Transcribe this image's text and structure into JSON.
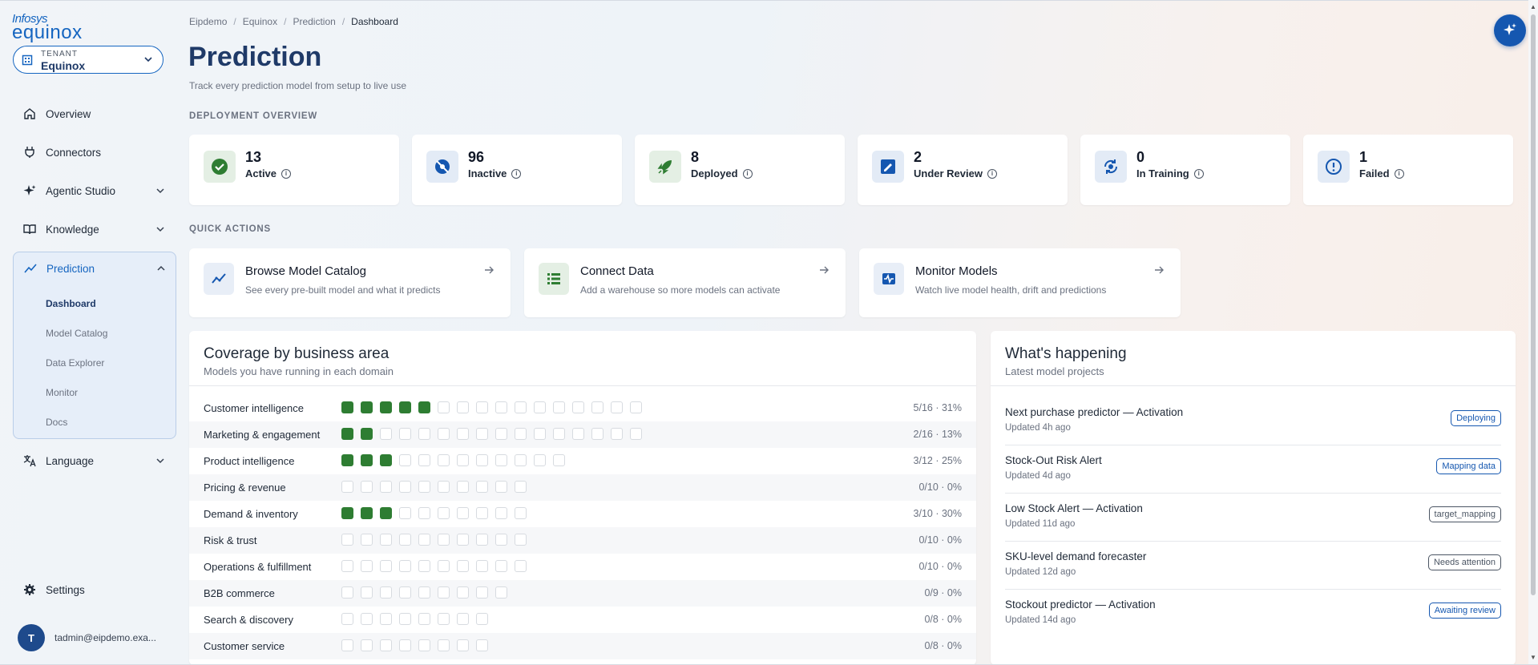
{
  "brand": {
    "line1": "Infosys",
    "line2": "equinox"
  },
  "tenant": {
    "label": "TENANT",
    "value": "Equinox"
  },
  "nav": {
    "overview": "Overview",
    "connectors": "Connectors",
    "agentic_studio": "Agentic Studio",
    "knowledge": "Knowledge",
    "prediction": "Prediction",
    "prediction_sub": [
      "Dashboard",
      "Model Catalog",
      "Data Explorer",
      "Monitor",
      "Docs"
    ],
    "language": "Language",
    "settings": "Settings"
  },
  "user": {
    "initial": "T",
    "email": "tadmin@eipdemo.exa..."
  },
  "breadcrumb": [
    "Eipdemo",
    "Equinox",
    "Prediction",
    "Dashboard"
  ],
  "page": {
    "title": "Prediction",
    "subtitle": "Track every prediction model from setup to live use"
  },
  "deployment": {
    "label": "DEPLOYMENT OVERVIEW",
    "stats": [
      {
        "value": "13",
        "label": "Active",
        "icon": "check-circle-icon",
        "color": "#2e7d32"
      },
      {
        "value": "96",
        "label": "Inactive",
        "icon": "eye-off-icon",
        "color": "#1557b0"
      },
      {
        "value": "8",
        "label": "Deployed",
        "icon": "rocket-icon",
        "color": "#2e7d32"
      },
      {
        "value": "2",
        "label": "Under Review",
        "icon": "review-pen-icon",
        "color": "#1557b0"
      },
      {
        "value": "0",
        "label": "In Training",
        "icon": "training-cycle-icon",
        "color": "#1557b0"
      },
      {
        "value": "1",
        "label": "Failed",
        "icon": "alert-circle-icon",
        "color": "#1557b0"
      }
    ]
  },
  "quick_actions": {
    "label": "QUICK ACTIONS",
    "items": [
      {
        "title": "Browse Model Catalog",
        "desc": "See every pre-built model and what it predicts",
        "icon": "trend-line-icon"
      },
      {
        "title": "Connect Data",
        "desc": "Add a warehouse so more models can activate",
        "icon": "database-list-icon"
      },
      {
        "title": "Monitor Models",
        "desc": "Watch live model health, drift and predictions",
        "icon": "pulse-monitor-icon"
      }
    ]
  },
  "coverage": {
    "title": "Coverage by business area",
    "subtitle": "Models you have running in each domain",
    "rows": [
      {
        "name": "Customer intelligence",
        "active": 5,
        "total": 16,
        "value": "5/16 · 31%"
      },
      {
        "name": "Marketing & engagement",
        "active": 2,
        "total": 16,
        "value": "2/16 · 13%"
      },
      {
        "name": "Product intelligence",
        "active": 3,
        "total": 12,
        "value": "3/12 · 25%"
      },
      {
        "name": "Pricing & revenue",
        "active": 0,
        "total": 10,
        "value": "0/10 · 0%"
      },
      {
        "name": "Demand & inventory",
        "active": 3,
        "total": 10,
        "value": "3/10 · 30%"
      },
      {
        "name": "Risk & trust",
        "active": 0,
        "total": 10,
        "value": "0/10 · 0%"
      },
      {
        "name": "Operations & fulfillment",
        "active": 0,
        "total": 10,
        "value": "0/10 · 0%"
      },
      {
        "name": "B2B commerce",
        "active": 0,
        "total": 9,
        "value": "0/9 · 0%"
      },
      {
        "name": "Search & discovery",
        "active": 0,
        "total": 8,
        "value": "0/8 · 0%"
      },
      {
        "name": "Customer service",
        "active": 0,
        "total": 8,
        "value": "0/8 · 0%"
      }
    ]
  },
  "happening": {
    "title": "What's happening",
    "subtitle": "Latest model projects",
    "items": [
      {
        "title": "Next purchase predictor — Activation",
        "updated": "Updated 4h ago",
        "badge": "Deploying",
        "badge_color": "#1557b0"
      },
      {
        "title": "Stock-Out Risk Alert",
        "updated": "Updated 4d ago",
        "badge": "Mapping data",
        "badge_color": "#1557b0"
      },
      {
        "title": "Low Stock Alert — Activation",
        "updated": "Updated 11d ago",
        "badge": "target_mapping",
        "badge_color": "#4b5563"
      },
      {
        "title": "SKU-level demand forecaster",
        "updated": "Updated 12d ago",
        "badge": "Needs attention",
        "badge_color": "#4b5563"
      },
      {
        "title": "Stockout predictor — Activation",
        "updated": "Updated 14d ago",
        "badge": "Awaiting review",
        "badge_color": "#1557b0"
      }
    ]
  }
}
